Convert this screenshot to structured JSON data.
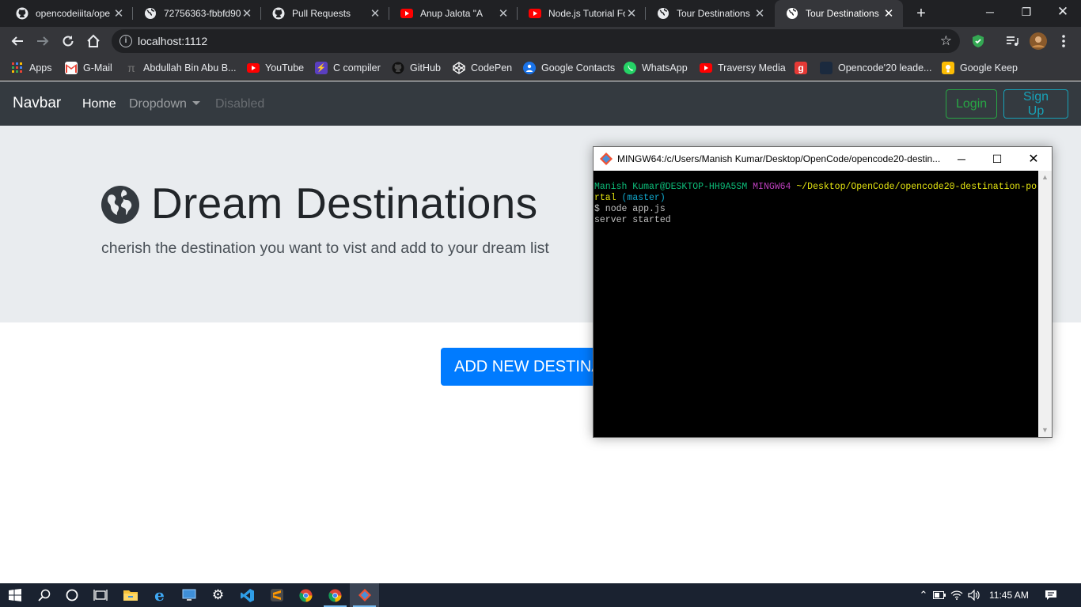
{
  "browser": {
    "tabs": [
      {
        "title": "opencodeiiita/ope",
        "icon": "github-icon"
      },
      {
        "title": "72756363-fbbfd90",
        "icon": "globe-icon"
      },
      {
        "title": "Pull Requests",
        "icon": "github-icon"
      },
      {
        "title": "Anup Jalota \"A",
        "icon": "youtube-icon"
      },
      {
        "title": "Node.js Tutorial Fo",
        "icon": "youtube-icon"
      },
      {
        "title": "Tour Destinations",
        "icon": "globe-icon"
      },
      {
        "title": "Tour Destinations",
        "icon": "globe-icon",
        "active": true
      }
    ],
    "url": "localhost:1112",
    "bookmarks": [
      {
        "label": "Apps",
        "icon": "apps-grid-icon"
      },
      {
        "label": "G-Mail",
        "icon": "gmail-icon"
      },
      {
        "label": "Abdullah Bin Abu B...",
        "icon": "pi-icon"
      },
      {
        "label": "YouTube",
        "icon": "youtube-icon"
      },
      {
        "label": "C compiler",
        "icon": "compiler-icon"
      },
      {
        "label": "GitHub",
        "icon": "github-icon"
      },
      {
        "label": "CodePen",
        "icon": "codepen-icon"
      },
      {
        "label": "Google Contacts",
        "icon": "contacts-icon"
      },
      {
        "label": "WhatsApp",
        "icon": "whatsapp-icon"
      },
      {
        "label": "Traversy Media",
        "icon": "youtube-icon"
      },
      {
        "label": "",
        "icon": "g-red-icon"
      },
      {
        "label": "Opencode'20 leade...",
        "icon": "opencode-icon"
      },
      {
        "label": "Google Keep",
        "icon": "keep-icon"
      }
    ]
  },
  "navbar": {
    "brand": "Navbar",
    "home": "Home",
    "dropdown": "Dropdown",
    "disabled": "Disabled",
    "login": "Login",
    "signup": "Sign Up"
  },
  "hero": {
    "title": "Dream Destinations",
    "lead": "cherish the destination you want to vist and add to your dream list"
  },
  "add_button": "ADD NEW DESTINATION",
  "terminal": {
    "title": "MINGW64:/c/Users/Manish Kumar/Desktop/OpenCode/opencode20-destin...",
    "user": "Manish Kumar@DESKTOP-HH9A5SM",
    "shell": "MINGW64",
    "path": "~/Desktop/OpenCode/opencode20-destination-portal",
    "branch": "(master)",
    "command": "$ node app.js",
    "output": "server started"
  },
  "taskbar": {
    "time": "11:45 AM"
  },
  "colors": {
    "navbar_bg": "#343a40",
    "jumbotron_bg": "#e9ecef",
    "primary": "#007bff",
    "success": "#28a745",
    "info": "#17a2b8"
  }
}
